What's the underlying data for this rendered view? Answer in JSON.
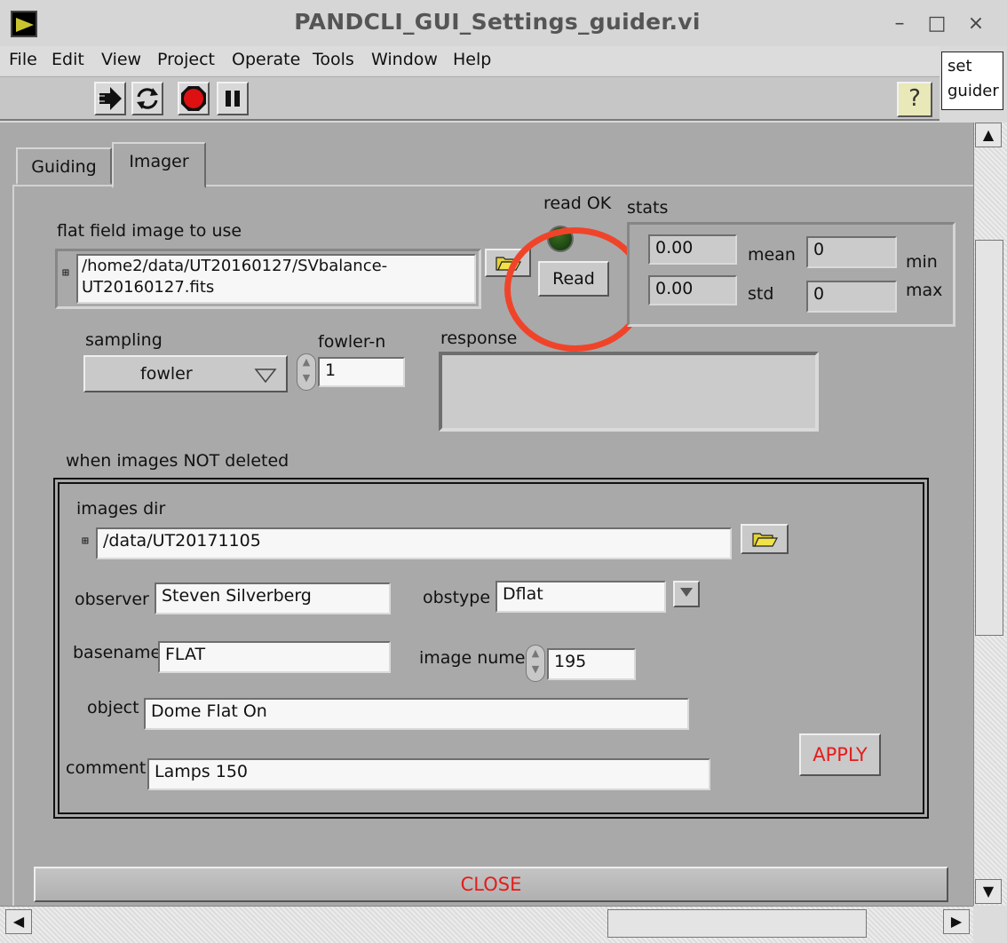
{
  "window": {
    "title": "PANDCLI_GUI_Settings_guider.vi",
    "minimize_glyph": "–",
    "maximize_glyph": "□",
    "close_glyph": "×"
  },
  "menu": [
    "File",
    "Edit",
    "View",
    "Project",
    "Operate",
    "Tools",
    "Window",
    "Help"
  ],
  "side_label": [
    "set",
    "guider"
  ],
  "toolbar": {
    "icons": [
      "run-arrow-icon",
      "run-continuously-icon",
      "abort-icon",
      "pause-icon"
    ],
    "help_glyph": "?"
  },
  "tabs": {
    "guiding": "Guiding",
    "imager": "Imager"
  },
  "imager": {
    "flat_label": "flat field image to use",
    "flat_path_line1": "/home2/data/UT20160127/SVbalance-",
    "flat_path_line2": "UT20160127.fits",
    "read_ok_label": "read OK",
    "read_button": "Read",
    "stats_label": "stats",
    "stats": {
      "mean_value": "0.00",
      "mean_label": "mean",
      "std_value": "0.00",
      "std_label": "std",
      "min_value": "0",
      "min_label": "min",
      "max_value": "0",
      "max_label": "max"
    },
    "sampling_label": "sampling",
    "sampling_value": "fowler",
    "fowler_n_label": "fowler-n",
    "fowler_n_value": "1",
    "response_label": "response",
    "response_value": ""
  },
  "images_section": {
    "title": "when images NOT deleted",
    "images_dir_label": "images dir",
    "images_dir_value": "/data/UT20171105",
    "observer_label": "observer",
    "observer_value": "Steven Silverberg",
    "obstype_label": "obstype",
    "obstype_value": "Dflat",
    "basename_label": "basename",
    "basename_value": "FLAT",
    "image_numer_label": "image numer",
    "image_numer_value": "195",
    "object_label": "object",
    "object_value": "Dome Flat On",
    "comment_label": "comment",
    "comment_value": "Lamps 150",
    "apply_button": "APPLY"
  },
  "close_button": "CLOSE",
  "colors": {
    "panel": "#a9a9a9",
    "accent_red": "#e41c1c",
    "highlight_ring": "#f0442a",
    "led_off": "#1f4a14"
  },
  "scroll": {
    "up": "▲",
    "down": "▼",
    "left": "◀",
    "right": "▶"
  }
}
